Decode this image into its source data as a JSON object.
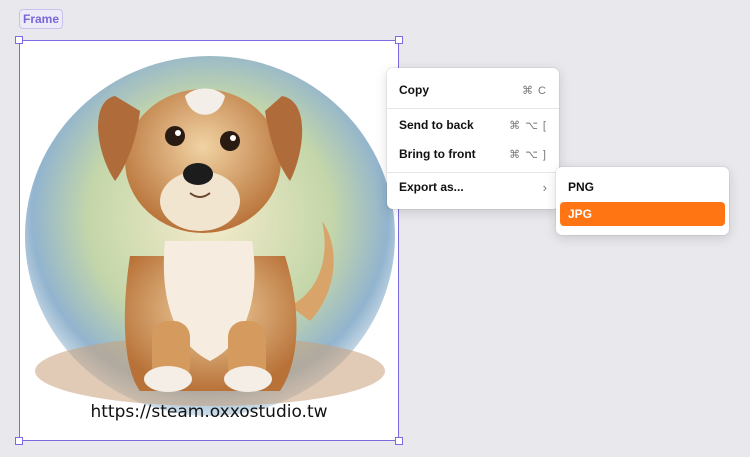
{
  "frame": {
    "tag": "Frame"
  },
  "canvas": {
    "watermark_url": "https://steam.oxxostudio.tw"
  },
  "context_menu": {
    "items": [
      {
        "label": "Copy",
        "shortcut": "⌘ C"
      },
      {
        "label": "Send to back",
        "shortcut": "⌘ ⌥ ["
      },
      {
        "label": "Bring to front",
        "shortcut": "⌘ ⌥ ]"
      },
      {
        "label": "Export as...",
        "chevron": "›"
      }
    ]
  },
  "export_submenu": {
    "items": [
      {
        "label": "PNG",
        "active": false
      },
      {
        "label": "JPG",
        "active": true
      }
    ]
  },
  "colors": {
    "selection": "#7b6be0",
    "accent": "#ff7514"
  }
}
